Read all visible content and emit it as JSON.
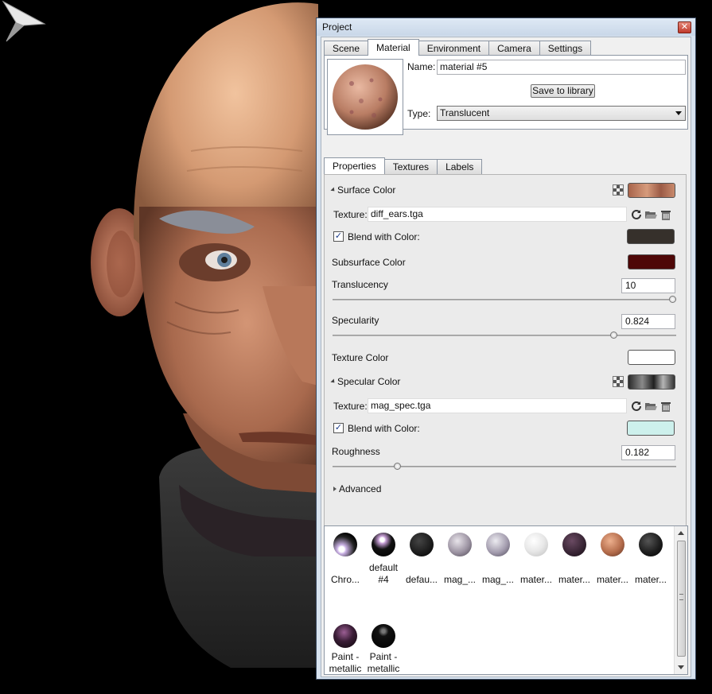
{
  "window": {
    "title": "Project",
    "close_label": "✕"
  },
  "top_tabs": [
    "Scene",
    "Material",
    "Environment",
    "Camera",
    "Settings"
  ],
  "top_tabs_active": "Material",
  "material": {
    "name_label": "Name:",
    "name_value": "material #5",
    "save_button": "Save to library",
    "type_label": "Type:",
    "type_value": "Translucent"
  },
  "prop_tabs": [
    "Properties",
    "Textures",
    "Labels"
  ],
  "prop_tabs_active": "Properties",
  "properties": {
    "surface_color": {
      "label": "Surface Color",
      "texture_label": "Texture:",
      "texture_value": "diff_ears.tga",
      "blend_label": "Blend with Color:",
      "blend_checked": true,
      "blend_color": "#36302b"
    },
    "subsurface_color": {
      "label": "Subsurface Color",
      "color": "#4e0707"
    },
    "translucency": {
      "label": "Translucency",
      "value": "10",
      "fraction": 1.0
    },
    "specularity": {
      "label": "Specularity",
      "value": "0.824",
      "fraction": 0.824
    },
    "texture_color": {
      "label": "Texture Color",
      "color": "#ffffff"
    },
    "specular_color": {
      "label": "Specular Color",
      "texture_label": "Texture:",
      "texture_value": "mag_spec.tga",
      "blend_label": "Blend with Color:",
      "blend_checked": true,
      "blend_color": "#cdf0ec"
    },
    "roughness": {
      "label": "Roughness",
      "value": "0.182",
      "fraction": 0.182
    },
    "advanced": {
      "label": "Advanced"
    }
  },
  "library": [
    {
      "label": "Chro...",
      "ball": "chrome"
    },
    {
      "label": "default #4",
      "ball": "black-gloss"
    },
    {
      "label": "defau...",
      "ball": "black-matte"
    },
    {
      "label": "mag_...",
      "ball": "mag-gray"
    },
    {
      "label": "mag_...",
      "ball": "mag-gray2"
    },
    {
      "label": "mater...",
      "ball": "white-gloss"
    },
    {
      "label": "mater...",
      "ball": "dark-purple"
    },
    {
      "label": "mater...",
      "ball": "skin"
    },
    {
      "label": "mater...",
      "ball": "dark-gloss"
    },
    {
      "label": "Paint - metallic ultra",
      "ball": "paint-purple"
    },
    {
      "label": "Paint - metallic ultra",
      "ball": "paint-black"
    }
  ]
}
